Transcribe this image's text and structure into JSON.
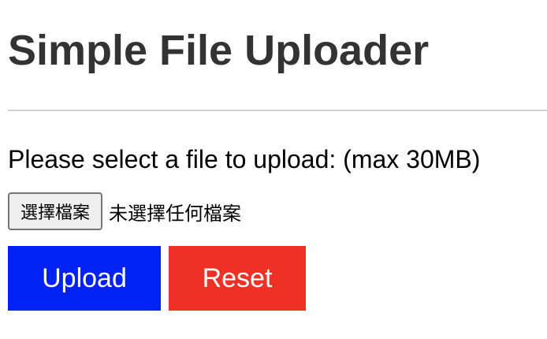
{
  "page": {
    "title": "Simple File Uploader",
    "prompt": "Please select a file to upload: (max 30MB)"
  },
  "file_input": {
    "button_label": "選擇檔案",
    "status_text": "未選擇任何檔案"
  },
  "actions": {
    "upload_label": "Upload",
    "reset_label": "Reset"
  },
  "colors": {
    "upload": "#0022f5",
    "reset": "#ee3124"
  }
}
